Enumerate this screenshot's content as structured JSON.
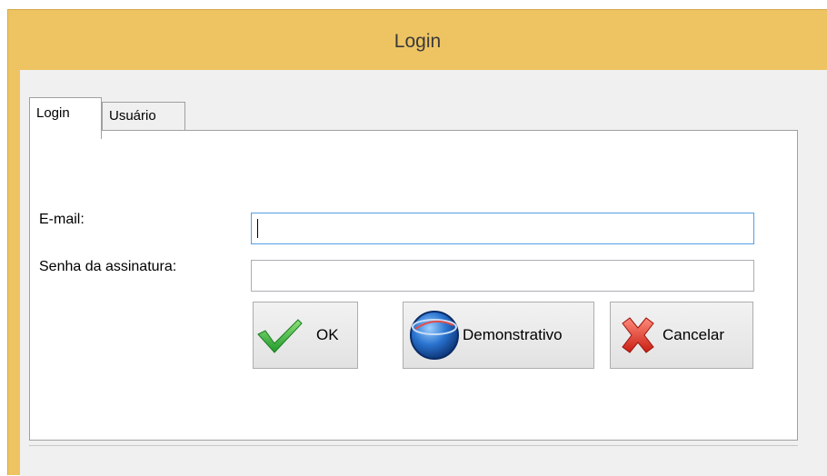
{
  "window": {
    "title": "Login"
  },
  "tabs": [
    {
      "label": "Login",
      "active": true
    },
    {
      "label": "Usuário",
      "active": false
    }
  ],
  "form": {
    "email_label": "E-mail:",
    "email_value": "",
    "senha_label": "Senha da assinatura:",
    "senha_value": ""
  },
  "buttons": {
    "ok": {
      "label": "OK",
      "icon": "green-checkmark-icon"
    },
    "demo": {
      "label": "Demonstrativo",
      "icon": "blue-globe-logo-icon"
    },
    "cancel": {
      "label": "Cancelar",
      "icon": "red-x-icon"
    }
  },
  "colors": {
    "title_bar": "#eec463",
    "active_field_border": "#569de5",
    "ok_icon": "#3cb83c",
    "cancel_icon": "#e23a2a",
    "demo_icon": "#1c5fb3"
  }
}
